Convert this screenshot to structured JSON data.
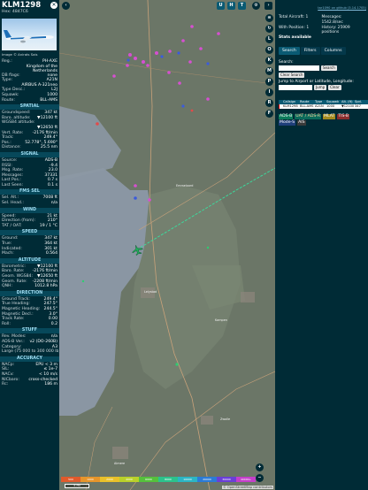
{
  "aircraft": {
    "callsign": "KLM1298",
    "hex_label": "Hex: 4847C6",
    "photo_credit": "Image © Anirats Sais"
  },
  "details": {
    "rows": [
      {
        "k": "Reg.:",
        "v": "PH-AXE",
        "multi": false
      },
      {
        "k": "",
        "v": "Kingdom of the Netherlands",
        "multi": true
      },
      {
        "k": "DB flags:",
        "v": "none",
        "multi": false
      },
      {
        "k": "Type:",
        "v": "A21N",
        "multi": false
      },
      {
        "k": "",
        "v": "AIRBUS A-321neo",
        "multi": false
      },
      {
        "k": "Type Desc.:",
        "v": "L2J",
        "multi": false
      },
      {
        "k": "Squawk:",
        "v": "1000",
        "multi": false
      },
      {
        "k": "Route:",
        "v": "BLL-AMS",
        "multi": false
      }
    ]
  },
  "sections": [
    {
      "title": "SPATIAL",
      "rows": [
        {
          "k": "Groundspeed:",
          "v": "347 kt"
        },
        {
          "k": "Baro. altitude:",
          "v": "▼12100 ft"
        },
        {
          "k": "WGS84 altitude:",
          "v": ""
        },
        {
          "k": "",
          "v": "▼12650 ft"
        },
        {
          "k": "Vert. Rate:",
          "v": "-2176 ft/min"
        },
        {
          "k": "Track:",
          "v": "249.4°"
        },
        {
          "k": "Pos.:",
          "v": "52.778°, 5.690°"
        },
        {
          "k": "Distance:",
          "v": "25.5 nm"
        }
      ]
    },
    {
      "title": "SIGNAL",
      "rows": [
        {
          "k": "Source:",
          "v": "ADS-B"
        },
        {
          "k": "RSSI:",
          "v": "-9.4"
        },
        {
          "k": "Msg. Rate:",
          "v": "23.0"
        },
        {
          "k": "Messages:",
          "v": "37331"
        },
        {
          "k": "Last Pos.:",
          "v": "0.7 s"
        },
        {
          "k": "Last Seen:",
          "v": "0.1 s"
        }
      ]
    },
    {
      "title": "FMS SEL",
      "rows": [
        {
          "k": "Sel. Alt.:",
          "v": "7008 ft"
        },
        {
          "k": "Sel. Head.:",
          "v": "n/a"
        }
      ]
    },
    {
      "title": "WIND",
      "rows": [
        {
          "k": "Speed:",
          "v": "21 kt"
        },
        {
          "k": "Direction (from):",
          "v": "210°"
        },
        {
          "k": "TAT / OAT:",
          "v": "19 / 1 °C"
        }
      ]
    },
    {
      "title": "SPEED",
      "rows": [
        {
          "k": "Ground:",
          "v": "347 kt"
        },
        {
          "k": "True:",
          "v": "364 kt"
        },
        {
          "k": "Indicated:",
          "v": "301 kt"
        },
        {
          "k": "Mach:",
          "v": "0.564"
        }
      ]
    },
    {
      "title": "ALTITUDE",
      "rows": [
        {
          "k": "Barometric:",
          "v": "▼12100 ft"
        },
        {
          "k": "Baro. Rate:",
          "v": "-2176 ft/min"
        },
        {
          "k": "Geom. WGS84:",
          "v": "▼12650 ft"
        },
        {
          "k": "Geom. Rate:",
          "v": "-2208 ft/min"
        },
        {
          "k": "QNH:",
          "v": "1012.8 hPa"
        }
      ]
    },
    {
      "title": "DIRECTION",
      "rows": [
        {
          "k": "Ground Track:",
          "v": "249.4°"
        },
        {
          "k": "True Heading:",
          "v": "247.5°"
        },
        {
          "k": "Magnetic Heading:",
          "v": "244.5°"
        },
        {
          "k": "Magnetic Decl.:",
          "v": "3.0°"
        },
        {
          "k": "Track Rate:",
          "v": "0.00"
        },
        {
          "k": "Roll:",
          "v": "0.2"
        }
      ]
    },
    {
      "title": "STUFF",
      "rows": [
        {
          "k": "Rev. Modes:",
          "v": "n/a"
        },
        {
          "k": "ADS-B Ver.:",
          "v": "v2 (DO-260B)"
        },
        {
          "k": "Category:",
          "v": "A3"
        },
        {
          "k": "Large (75 000 to 300 000 lb)",
          "v": ""
        }
      ]
    },
    {
      "title": "ACCURACY",
      "rows": [
        {
          "k": "NACp:",
          "v": "EPU < 3 m"
        },
        {
          "k": "SIL:",
          "v": "≤ 1e-7"
        },
        {
          "k": "NACv:",
          "v": "< 10 m/s"
        },
        {
          "k": "NICbaro:",
          "v": "cross-checked"
        },
        {
          "k": "Rc:",
          "v": "186 m"
        }
      ]
    }
  ],
  "map": {
    "top_buttons": [
      "U",
      "H",
      "T"
    ],
    "side_buttons": [
      "L",
      "O",
      "K",
      "M",
      "P",
      "I",
      "R",
      "F"
    ],
    "labels": [
      "Emmeloord",
      "Lelystad",
      "Almere",
      "Kampen",
      "Zwolle"
    ],
    "scale": "5 mi",
    "legend": [
      "500",
      "1000",
      "2000",
      "4000",
      "6000",
      "8000",
      "10000",
      "20000",
      "30000",
      "40000+"
    ],
    "attribution": "© OpenStreetMap contributors",
    "zoom_in": "+",
    "zoom_out": "−"
  },
  "panel": {
    "github_link": "tar1090 on github (3.14.1705)",
    "total_label": "Total Aircraft: 1",
    "messages_label": "Messages:",
    "messages_value": "1542.8/sec",
    "position_label": "With Position: 1",
    "history_label": "History: 25909 positions",
    "stats_link": "Stats available",
    "tabs": [
      "Search",
      "Filters",
      "Columns"
    ],
    "search_label": "Search:",
    "search_button": "Search",
    "clear_search_button": "Clear Search",
    "jump_label": "Jump to Airport or Latitude, Longitude:",
    "jump_button": "Jump",
    "clear_button": "Clear",
    "table_headers": [
      "",
      "Callsign",
      "Route",
      "Type",
      "Squawk",
      "Alt. (ft)",
      "Spd."
    ],
    "table_row": [
      "",
      "KLM1298",
      "BLL-AMS",
      "A21N",
      "1000",
      "▼12100",
      "347"
    ],
    "filters": [
      "ADS-B",
      "UAT / ADS-R",
      "MLAT",
      "TIS-B",
      "Mode-S",
      "AIS"
    ]
  },
  "colors": {
    "sidebar_bg": "#002b36",
    "accent": "#0a5a73",
    "aircraft": "#1fae5a",
    "track": "#38e0a0"
  }
}
